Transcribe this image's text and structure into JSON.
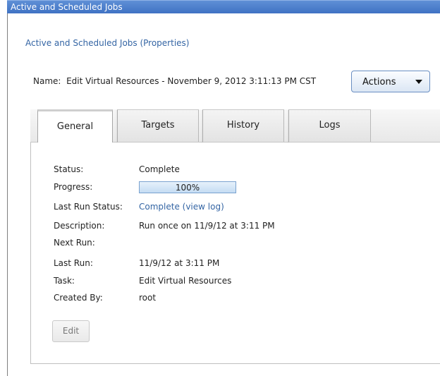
{
  "window": {
    "title": "Active and Scheduled Jobs"
  },
  "breadcrumb": "Active and Scheduled Jobs (Properties)",
  "job": {
    "name_label": "Name:",
    "name_value": "Edit Virtual Resources - November 9, 2012 3:11:13 PM CST"
  },
  "actions": {
    "label": "Actions",
    "icon": "chevron-down-icon"
  },
  "tabs": [
    {
      "label": "General",
      "active": true
    },
    {
      "label": "Targets",
      "active": false
    },
    {
      "label": "History",
      "active": false
    },
    {
      "label": "Logs",
      "active": false
    }
  ],
  "general": {
    "status": {
      "label": "Status:",
      "value": "Complete"
    },
    "progress": {
      "label": "Progress:",
      "text": "100%",
      "fraction": 1.0
    },
    "last_run_status": {
      "label": "Last Run Status:",
      "value": "Complete (view log)"
    },
    "description": {
      "label": "Description:",
      "value": "Run once on 11/9/12 at 3:11 PM"
    },
    "next_run": {
      "label": "Next Run:",
      "value": ""
    },
    "last_run": {
      "label": "Last Run:",
      "value": "11/9/12 at 3:11 PM"
    },
    "task": {
      "label": "Task:",
      "value": "Edit Virtual Resources"
    },
    "created_by": {
      "label": "Created By:",
      "value": "root"
    },
    "edit_label": "Edit"
  },
  "colors": {
    "titlebar": "#4a7fcf",
    "link": "#3465a4",
    "progress_fill": "#c4dcf3"
  }
}
